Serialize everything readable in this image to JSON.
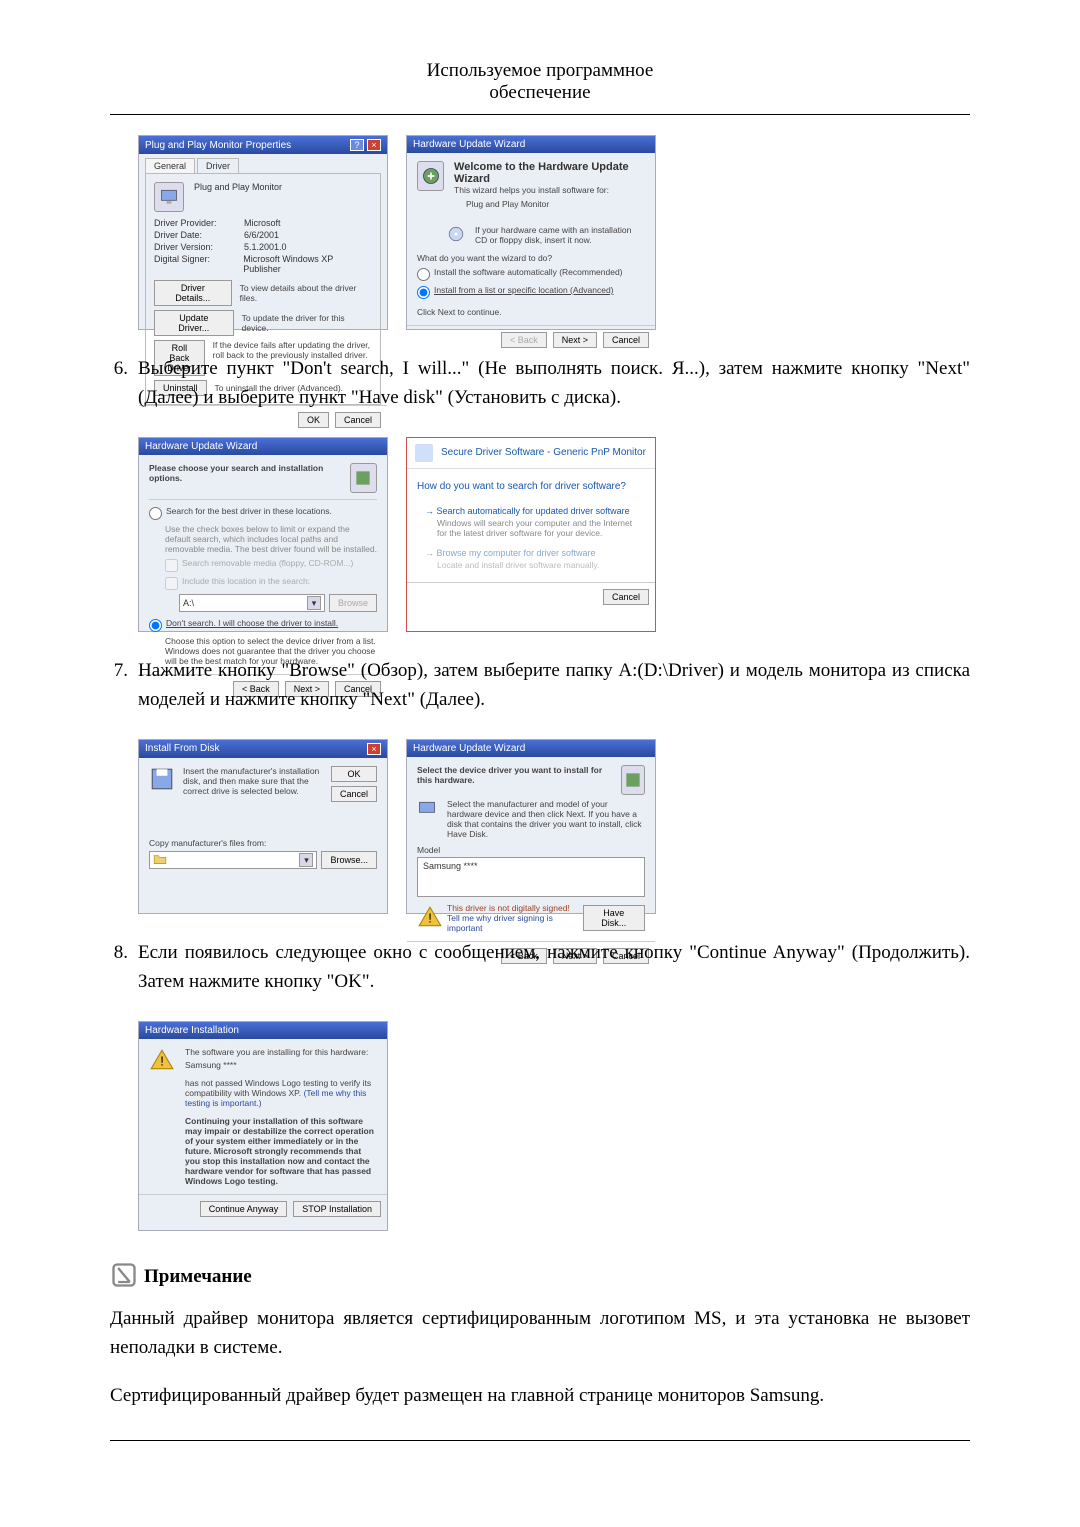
{
  "header": {
    "line1": "Используемое программное",
    "line2": "обеспечение"
  },
  "steps": {
    "s6": {
      "num": "6.",
      "text": "Выберите пункт \"Don't search, I will...\" (Не выполнять поиск. Я...), затем нажмите кнопку \"Next\" (Далее) и выберите пункт \"Have disk\" (Установить с диска)."
    },
    "s7": {
      "num": "7.",
      "text": "Нажмите кнопку \"Browse\" (Обзор), затем выберите папку A:(D:\\Driver) и модель монитора из списка моделей и нажмите кнопку \"Next\" (Далее)."
    },
    "s8": {
      "num": "8.",
      "text": "Если появилось следующее окно с сообщением, нажмите кнопку \"Continue Anyway\" (Продолжить). Затем нажмите кнопку \"OK\"."
    }
  },
  "fig1": {
    "title": "Plug and Play Monitor Properties",
    "tab_general": "General",
    "tab_driver": "Driver",
    "heading": "Plug and Play Monitor",
    "row_provider_l": "Driver Provider:",
    "row_provider_v": "Microsoft",
    "row_date_l": "Driver Date:",
    "row_date_v": "6/6/2001",
    "row_version_l": "Driver Version:",
    "row_version_v": "5.1.2001.0",
    "row_signer_l": "Digital Signer:",
    "row_signer_v": "Microsoft Windows XP Publisher",
    "btn_details": "Driver Details...",
    "desc_details": "To view details about the driver files.",
    "btn_update": "Update Driver...",
    "desc_update": "To update the driver for this device.",
    "btn_rollback": "Roll Back Driver",
    "desc_rollback": "If the device fails after updating the driver, roll back to the previously installed driver.",
    "btn_uninstall": "Uninstall",
    "desc_uninstall": "To uninstall the driver (Advanced).",
    "ok": "OK",
    "cancel": "Cancel"
  },
  "fig2": {
    "title": "Hardware Update Wizard",
    "welcome": "Welcome to the Hardware Update Wizard",
    "sub": "This wizard helps you install software for:",
    "device": "Plug and Play Monitor",
    "hint": "If your hardware came with an installation CD or floppy disk, insert it now.",
    "ask": "What do you want the wizard to do?",
    "opt1": "Install the software automatically (Recommended)",
    "opt2": "Install from a list or specific location (Advanced)",
    "click_next": "Click Next to continue.",
    "back": "< Back",
    "next": "Next >",
    "cancel": "Cancel"
  },
  "fig3": {
    "title": "Hardware Update Wizard",
    "heading": "Please choose your search and installation options.",
    "opt1": "Search for the best driver in these locations.",
    "opt1_desc": "Use the check boxes below to limit or expand the default search, which includes local paths and removable media. The best driver found will be installed.",
    "chk1": "Search removable media (floppy, CD-ROM...)",
    "chk2": "Include this location in the search:",
    "path": "A:\\",
    "browse": "Browse",
    "opt2": "Don't search. I will choose the driver to install.",
    "opt2_desc": "Choose this option to select the device driver from a list. Windows does not guarantee that the driver you choose will be the best match for your hardware.",
    "back": "< Back",
    "next": "Next >",
    "cancel": "Cancel"
  },
  "fig4": {
    "crumb": "Secure Driver Software - Generic PnP Monitor",
    "question": "How do you want to search for driver software?",
    "opt1_title": "Search automatically for updated driver software",
    "opt1_desc": "Windows will search your computer and the Internet for the latest driver software for your device.",
    "opt2_title": "Browse my computer for driver software",
    "opt2_desc": "Locate and install driver software manually.",
    "cancel": "Cancel"
  },
  "fig5": {
    "title": "Install From Disk",
    "msg": "Insert the manufacturer's installation disk, and then make sure that the correct drive is selected below.",
    "ok": "OK",
    "cancel": "Cancel",
    "copy_label": "Copy manufacturer's files from:",
    "browse": "Browse..."
  },
  "fig6": {
    "title": "Hardware Update Wizard",
    "heading": "Select the device driver you want to install for this hardware.",
    "desc": "Select the manufacturer and model of your hardware device and then click Next. If you have a disk that contains the driver you want to install, click Have Disk.",
    "model_label": "Model",
    "model_value": "Samsung ****",
    "warn": "This driver is not digitally signed!",
    "warn_link": "Tell me why driver signing is important",
    "have_disk": "Have Disk...",
    "back": "< Back",
    "next": "Next >",
    "cancel": "Cancel"
  },
  "fig7": {
    "title": "Hardware Installation",
    "line1": "The software you are installing for this hardware:",
    "device": "Samsung ****",
    "line2a": "has not passed Windows Logo testing to verify its compatibility with Windows XP.",
    "line2b": "(Tell me why this testing is important.)",
    "warn_para": "Continuing your installation of this software may impair or destabilize the correct operation of your system either immediately or in the future. Microsoft strongly recommends that you stop this installation now and contact the hardware vendor for software that has passed Windows Logo testing.",
    "btn_continue": "Continue Anyway",
    "btn_stop": "STOP Installation"
  },
  "note": {
    "label": "Примечание",
    "para1": "Данный драйвер монитора является сертифицированным логотипом MS, и эта установка не вызовет неполадки в системе.",
    "para2": "Сертифицированный драйвер будет размещен на главной странице мониторов Samsung."
  }
}
